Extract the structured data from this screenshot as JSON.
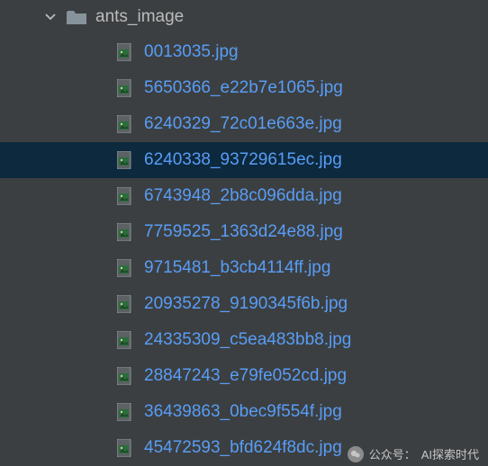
{
  "folder": {
    "name": "ants_image",
    "expanded": true
  },
  "files": [
    {
      "name": "0013035.jpg",
      "selected": false
    },
    {
      "name": "5650366_e22b7e1065.jpg",
      "selected": false
    },
    {
      "name": "6240329_72c01e663e.jpg",
      "selected": false
    },
    {
      "name": "6240338_93729615ec.jpg",
      "selected": true
    },
    {
      "name": "6743948_2b8c096dda.jpg",
      "selected": false
    },
    {
      "name": "7759525_1363d24e88.jpg",
      "selected": false
    },
    {
      "name": "9715481_b3cb4114ff.jpg",
      "selected": false
    },
    {
      "name": "20935278_9190345f6b.jpg",
      "selected": false
    },
    {
      "name": "24335309_c5ea483bb8.jpg",
      "selected": false
    },
    {
      "name": "28847243_e79fe052cd.jpg",
      "selected": false
    },
    {
      "name": "36439863_0bec9f554f.jpg",
      "selected": false
    },
    {
      "name": "45472593_bfd624f8dc.jpg",
      "selected": false
    }
  ],
  "watermark": {
    "prefix": "公众号：",
    "text": "AI探索时代"
  },
  "colors": {
    "background": "#3c3f41",
    "selection": "#0d293e",
    "file_text": "#589df6",
    "folder_text": "#bbbbbb"
  }
}
